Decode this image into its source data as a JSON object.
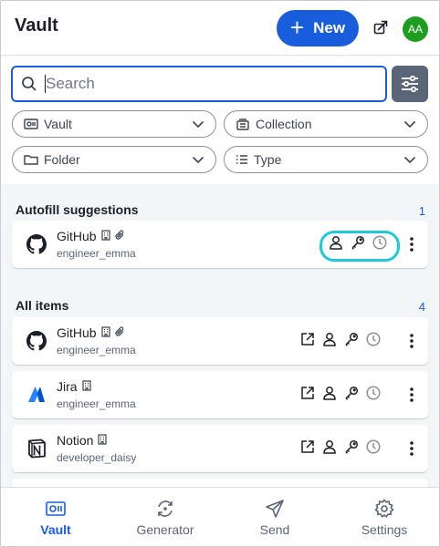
{
  "header": {
    "title": "Vault",
    "new_label": "New",
    "avatar_initials": "AA"
  },
  "search": {
    "placeholder": "Search",
    "value": ""
  },
  "filters": {
    "vault": "Vault",
    "collection": "Collection",
    "folder": "Folder",
    "type": "Type"
  },
  "autofill": {
    "title": "Autofill suggestions",
    "count": "1",
    "items": [
      {
        "name": "GitHub",
        "username": "engineer_emma"
      }
    ]
  },
  "all_items": {
    "title": "All items",
    "count": "4",
    "items": [
      {
        "name": "GitHub",
        "username": "engineer_emma"
      },
      {
        "name": "Jira",
        "username": "engineer_emma"
      },
      {
        "name": "Notion",
        "username": "developer_daisy"
      }
    ]
  },
  "nav": {
    "vault": "Vault",
    "generator": "Generator",
    "send": "Send",
    "settings": "Settings"
  },
  "colors": {
    "accent": "#175ddc",
    "highlight": "#1ccbd6",
    "avatar": "#1f9d20"
  }
}
